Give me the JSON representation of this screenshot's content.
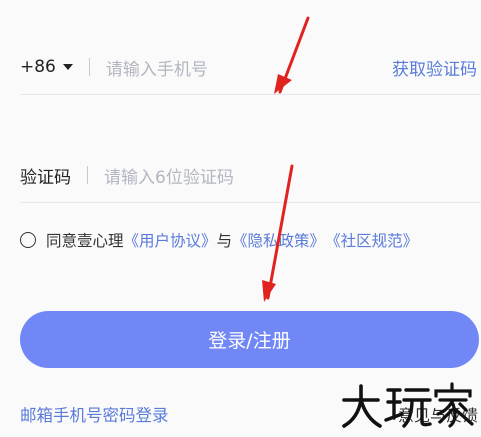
{
  "phone": {
    "country_code": "+86",
    "placeholder": "请输入手机号",
    "get_code": "获取验证码"
  },
  "code": {
    "label": "验证码",
    "placeholder": "请输入6位验证码"
  },
  "agreement": {
    "prefix": "同意壹心理",
    "user_agreement": "《用户协议》",
    "and": "与",
    "privacy_policy": "《隐私政策》",
    "community_rules": "《社区规范》"
  },
  "login_button": "登录/注册",
  "email_login": "邮箱手机号密码登录",
  "feedback": "意见与反馈",
  "watermark": "大玩家",
  "colors": {
    "accent": "#7187f6",
    "link": "#5a7bd8",
    "annotation_arrow": "#e0231f"
  },
  "icons": [
    "chevron-down-icon",
    "radio-unchecked-icon",
    "annotation-arrow-icon"
  ]
}
